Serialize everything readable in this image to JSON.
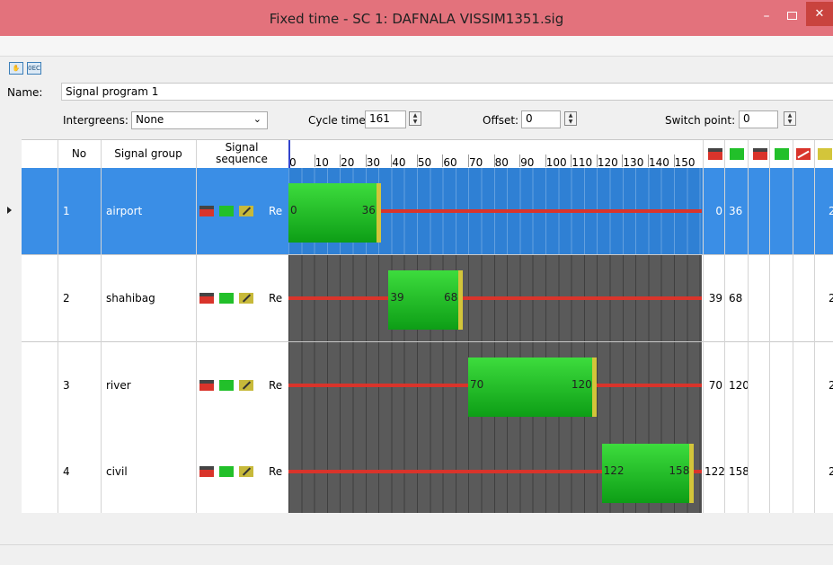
{
  "window": {
    "title": "Fixed time - SC 1: DAFNALA VISSIM1351.sig",
    "minimize": "–",
    "maximize": "",
    "close": "✕"
  },
  "toolbar": {
    "icon1": "edit-hand-icon",
    "icon2": "signal-sequence-icon",
    "icon2_text": "0EC"
  },
  "program": {
    "name_label": "Name:",
    "name_value": "Signal program 1",
    "intergreens_label": "Intergreens:",
    "intergreens_value": "None",
    "cycle_label": "Cycle time:",
    "cycle_value": "161",
    "offset_label": "Offset:",
    "offset_value": "0",
    "switch_label": "Switch point:",
    "switch_value": "0"
  },
  "table": {
    "headers": {
      "no": "No",
      "group": "Signal group",
      "sequence_line1": "Signal",
      "sequence_line2": "sequence"
    },
    "ticks": [
      "0",
      "10",
      "20",
      "30",
      "40",
      "50",
      "60",
      "70",
      "80",
      "90",
      "100",
      "110",
      "120",
      "130",
      "140",
      "150"
    ],
    "rows": [
      {
        "no": "1",
        "group": "airport",
        "seq": "Re",
        "start": 0,
        "end": 36,
        "start_label": "0",
        "end_label": "36",
        "col_start": "0",
        "col_end": "36",
        "col_last": "2",
        "selected": true
      },
      {
        "no": "2",
        "group": "shahibag",
        "seq": "Re",
        "start": 39,
        "end": 68,
        "start_label": "39",
        "end_label": "68",
        "col_start": "39",
        "col_end": "68",
        "col_last": "2"
      },
      {
        "no": "3",
        "group": "river",
        "seq": "Re",
        "start": 70,
        "end": 120,
        "start_label": "70",
        "end_label": "120",
        "col_start": "70",
        "col_end": "120",
        "col_last": "2"
      },
      {
        "no": "4",
        "group": "civil",
        "seq": "Re",
        "start": 122,
        "end": 158,
        "start_label": "122",
        "end_label": "158",
        "col_start": "122",
        "col_end": "158",
        "col_last": "2"
      }
    ]
  },
  "colors": {
    "red": "#d9342b",
    "green": "#22c02a",
    "amber": "#d3c53a",
    "selection": "#3a8ee6",
    "timeline": "#5a5a5a"
  },
  "cycle_max": 161
}
